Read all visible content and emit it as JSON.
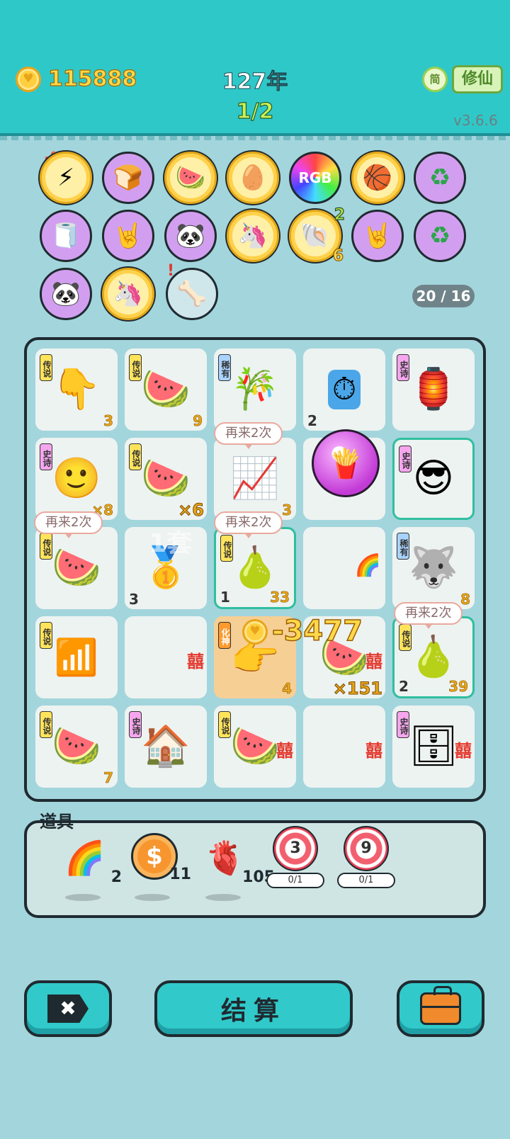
{
  "header": {
    "coins": "115888",
    "year": "127年",
    "page": "1/2",
    "lang_label": "简",
    "mode_label": "修仙",
    "version": "v3.6.6"
  },
  "relics": {
    "count": "20 / 16",
    "items": [
      {
        "icon": "lightning-icon",
        "emoji": "⚡"
      },
      {
        "icon": "toaster-icon",
        "emoji": "🍞"
      },
      {
        "icon": "fruit-basket-icon",
        "emoji": "🍉"
      },
      {
        "icon": "egg-icon",
        "emoji": "🥚"
      },
      {
        "icon": "rgb-icon",
        "emoji": "RGB"
      },
      {
        "icon": "basketballs-icon",
        "emoji": "🏀"
      },
      {
        "icon": "recycle-icon",
        "emoji": "♻"
      },
      {
        "icon": "tissue-box-icon",
        "emoji": "🧻"
      },
      {
        "icon": "rock-hand-icon",
        "emoji": "🤘"
      },
      {
        "icon": "panda-icon",
        "emoji": "🐼"
      },
      {
        "icon": "unicorn-icon",
        "emoji": "🦄"
      },
      {
        "icon": "shell-icon",
        "emoji": "🐚",
        "sub_top": "2",
        "sub_bottom": "6"
      },
      {
        "icon": "rock-hand-icon",
        "emoji": "🤘"
      },
      {
        "icon": "recycle-icon",
        "emoji": "♻"
      },
      {
        "icon": "panda-icon",
        "emoji": "🐼"
      },
      {
        "icon": "unicorn-icon",
        "emoji": "🦄"
      },
      {
        "icon": "dog-bowl-icon",
        "emoji": "🦴"
      }
    ]
  },
  "board": {
    "cells": [
      {
        "tag": "传说",
        "art": "👇",
        "count": "3"
      },
      {
        "tag": "传说",
        "art": "🍉",
        "count": "9"
      },
      {
        "tag": "稀有",
        "art": "🎋"
      },
      {
        "art": "⏱",
        "count_left": "2"
      },
      {
        "tag": "史诗",
        "art": "🏮"
      },
      {
        "tag": "史诗",
        "art": "🙂",
        "count": "×8"
      },
      {
        "tag": "传说",
        "art": "🍉",
        "mult": "×6"
      },
      {
        "art": "📈",
        "count": "3"
      },
      {
        "art": "🍟"
      },
      {
        "tag": "史诗",
        "art": "😎"
      },
      {
        "tag": "传说",
        "art": "🍉"
      },
      {
        "art": "🥇",
        "count_left": "3"
      },
      {
        "tag": "传说",
        "art": "🍐",
        "count_left": "1",
        "count": "33"
      },
      {
        "art": "🌈"
      },
      {
        "tag": "稀有",
        "art": "🐺",
        "count": "8"
      },
      {
        "tag": "传说",
        "art": "📶"
      },
      {
        "art": "",
        "xi": "囍"
      },
      {
        "tag": "化神",
        "art": "👉",
        "count": "4"
      },
      {
        "art": "🍉",
        "xi": "囍",
        "mult": "×151"
      },
      {
        "tag": "传说",
        "art": "🍐",
        "count_left": "2",
        "count": "39"
      },
      {
        "tag": "传说",
        "art": "🍉",
        "count": "7"
      },
      {
        "tag": "史诗",
        "art": "🏠"
      },
      {
        "tag": "传说",
        "art": "🍉",
        "xi": "囍"
      },
      {
        "art": "",
        "xi": "囍"
      },
      {
        "tag": "史诗",
        "art": "🗄",
        "xi": "囍"
      }
    ],
    "bubbles": [
      "再来2次",
      "再来2次",
      "再来2次",
      "再来2次"
    ],
    "popup": "-3477",
    "faded": "1套"
  },
  "items": {
    "label": "道具",
    "list": [
      {
        "icon": "rainbow-icon",
        "emoji": "🌈",
        "count": "2"
      },
      {
        "icon": "dollar-coin-icon",
        "emoji": "$",
        "count": "11"
      },
      {
        "icon": "liver-icon",
        "emoji": "🫀",
        "count": "105"
      },
      {
        "icon": "target-icon",
        "value": "3",
        "progress": "0/1"
      },
      {
        "icon": "target-icon",
        "value": "9",
        "progress": "0/1"
      }
    ]
  },
  "actions": {
    "close_label": "✖",
    "settle_label": "结算"
  }
}
